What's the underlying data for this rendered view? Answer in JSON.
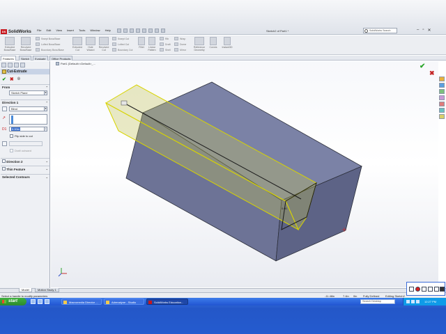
{
  "app": {
    "name": "SolidWorks",
    "document_title": "Sketch2 of Part1 *",
    "search_placeholder": "SolidWorks Search"
  },
  "menu": [
    "File",
    "Edit",
    "View",
    "Insert",
    "Tools",
    "Window",
    "Help"
  ],
  "ribbon": {
    "extruded_boss": "Extruded Boss/Base",
    "revolved_boss": "Revolved Boss/Base",
    "swept_boss": "Swept Boss/Base",
    "lofted_boss": "Lofted Boss/Base",
    "boundary_boss": "Boundary Boss/Base",
    "extruded_cut": "Extruded Cut",
    "hole_wizard": "Hole Wizard",
    "revolved_cut": "Revolved Cut",
    "swept_cut": "Swept Cut",
    "lofted_cut": "Lofted Cut",
    "boundary_cut": "Boundary Cut",
    "fillet": "Fillet",
    "linear_pattern": "Linear Pattern",
    "rib": "Rib",
    "draft": "Draft",
    "shell": "Shell",
    "wrap": "Wrap",
    "dome": "Dome",
    "mirror": "Mirror",
    "reference_geometry": "Reference Geometry",
    "curves": "Curves",
    "instant3d": "Instant3D"
  },
  "cmd_tabs": [
    "Features",
    "Sketch",
    "Evaluate",
    "Office Products"
  ],
  "feature_manager": {
    "title": "Cut-Extrude",
    "from_label": "From",
    "from_value": "Sketch Plane",
    "direction1_label": "Direction 1",
    "end_condition": "Blind",
    "depth_value": "0.00in",
    "flip_side_label": "Flip side to cut",
    "draft_label": "Draft outward",
    "direction2_label": "Direction 2",
    "thin_feature_label": "Thin Feature",
    "selected_contours_label": "Selected Contours"
  },
  "viewport": {
    "tree_label": "Part1 (Default<<Default>_..."
  },
  "bottom_tabs": [
    "Model",
    "Motion Study 1"
  ],
  "status": {
    "hint": "Select a handle to modify parameters",
    "x": "-11.46in",
    "y": "7.4in",
    "z": "0in",
    "state": "Fully Defined",
    "mode": "Editing Sketch2"
  },
  "taskbar": {
    "start": "start",
    "tasks": [
      "Macromedia Director ...",
      "Adrenalyne - Studio",
      "SolidWorks Education..."
    ],
    "desktop_search": "Search Desktop",
    "clock": "12:27 PM"
  }
}
